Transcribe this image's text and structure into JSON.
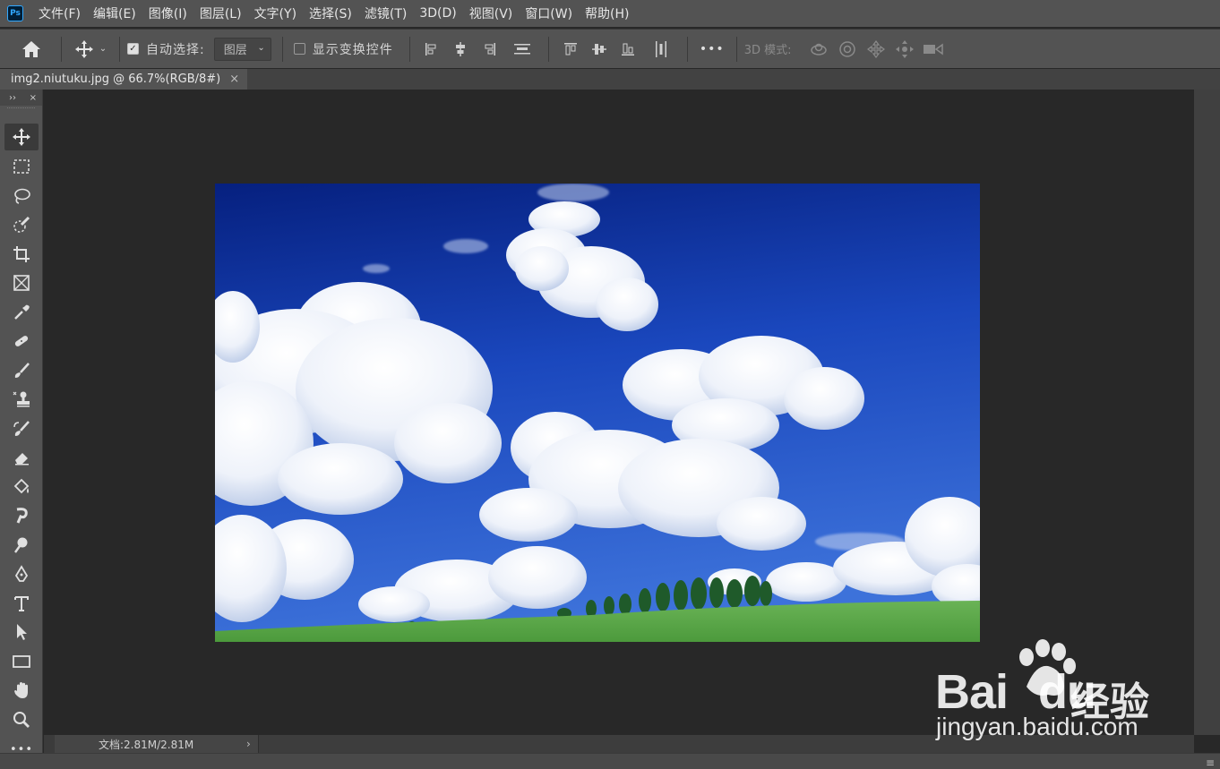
{
  "app": {
    "logo_text": "Ps"
  },
  "menu": [
    "文件(F)",
    "编辑(E)",
    "图像(I)",
    "图层(L)",
    "文字(Y)",
    "选择(S)",
    "滤镜(T)",
    "3D(D)",
    "视图(V)",
    "窗口(W)",
    "帮助(H)"
  ],
  "options": {
    "auto_select_label": "自动选择:",
    "auto_select_checked": true,
    "auto_select_target": "图层",
    "show_transform_label": "显示变换控件",
    "show_transform_checked": false,
    "more_label": "•••",
    "mode_3d_label": "3D 模式:"
  },
  "document": {
    "tab_title": "img2.niutuku.jpg @ 66.7%(RGB/8#)",
    "close_glyph": "×"
  },
  "toolbar": {
    "collapse_glyph": "››",
    "close_glyph": "×",
    "tools": [
      "move-tool",
      "rectangular-marquee-tool",
      "lasso-tool",
      "quick-selection-tool",
      "crop-tool",
      "frame-tool",
      "eyedropper-tool",
      "healing-brush-tool",
      "brush-tool",
      "clone-stamp-tool",
      "history-brush-tool",
      "eraser-tool",
      "paint-bucket-tool",
      "smudge-tool",
      "dodge-tool",
      "pen-tool",
      "type-tool",
      "path-selection-tool",
      "rectangle-tool",
      "hand-tool",
      "zoom-tool",
      "edit-toolbar"
    ],
    "active_tool": "move-tool",
    "more_glyph": "•••"
  },
  "status": {
    "doc_info": "文档:2.81M/2.81M",
    "arrow": "›"
  },
  "watermark": {
    "brand": "Bai",
    "brand_tail": "du",
    "cn": "经验",
    "url": "jingyan.baidu.com"
  },
  "colors": {
    "sky_top": "#0b2a8c",
    "sky_bottom": "#2b5fd0",
    "grass": "#5aa24a"
  }
}
